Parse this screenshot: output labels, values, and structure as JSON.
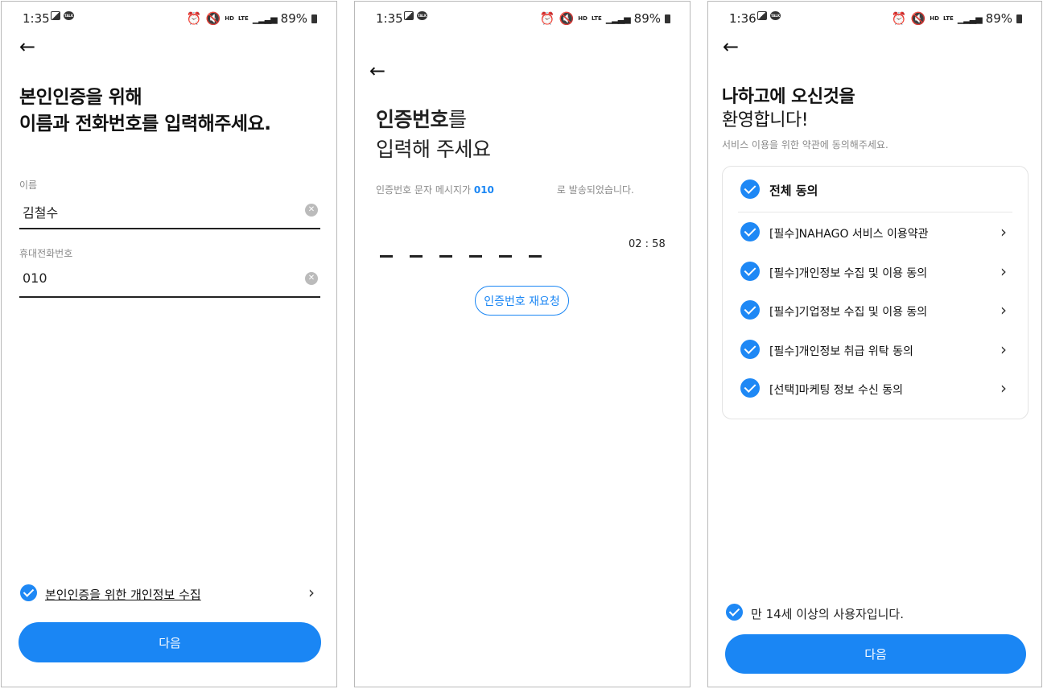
{
  "status_bar": {
    "screen1_time": "1:35",
    "screen2_time": "1:35",
    "screen3_time": "1:36",
    "battery": "89%",
    "talk_badge": "TALK",
    "hd_label": "HD",
    "voice_label": "VOICE",
    "lte_label": "LTE"
  },
  "screen1": {
    "title_line1": "본인인증을 위해",
    "title_line2": "이름과 전화번호를 입력해주세요.",
    "name_label": "이름",
    "name_value": "김철수",
    "phone_label": "휴대전화번호",
    "phone_value": "010",
    "consent_text": "본인인증을 위한 개인정보 수집",
    "next_label": "다음"
  },
  "screen2": {
    "title_bold": "인증번호",
    "title_suffix": "를",
    "title_line2": "입력해 주세요",
    "info_prefix": "인증번호 문자 메시지가 ",
    "info_number": "010",
    "info_suffix": "로 발송되었습니다.",
    "timer": "02 : 58",
    "resend_label": "인증번호 재요청"
  },
  "screen3": {
    "title_line1": "나하고에 오신것을",
    "title_line2": "환영합니다!",
    "subtitle": "서비스 이용을 위한 약관에 동의해주세요.",
    "agree_all": "전체 동의",
    "terms": [
      "[필수]NAHAGO 서비스 이용약관",
      "[필수]개인정보 수집 및 이용 동의",
      "[필수]기업정보 수집 및 이용 동의",
      "[필수]개인정보 취급 위탁 동의",
      "[선택]마케팅 정보 수신 동의"
    ],
    "age_confirm": "만 14세 이상의 사용자입니다.",
    "next_label": "다음"
  },
  "colors": {
    "accent": "#1a86f4",
    "text": "#111111",
    "muted": "#8a8a8a"
  },
  "icons": [
    "back-arrow-icon",
    "clear-icon",
    "check-icon",
    "chevron-right-icon",
    "alarm-icon",
    "mute-icon",
    "signal-icon",
    "battery-icon",
    "gallery-icon",
    "talk-icon"
  ]
}
